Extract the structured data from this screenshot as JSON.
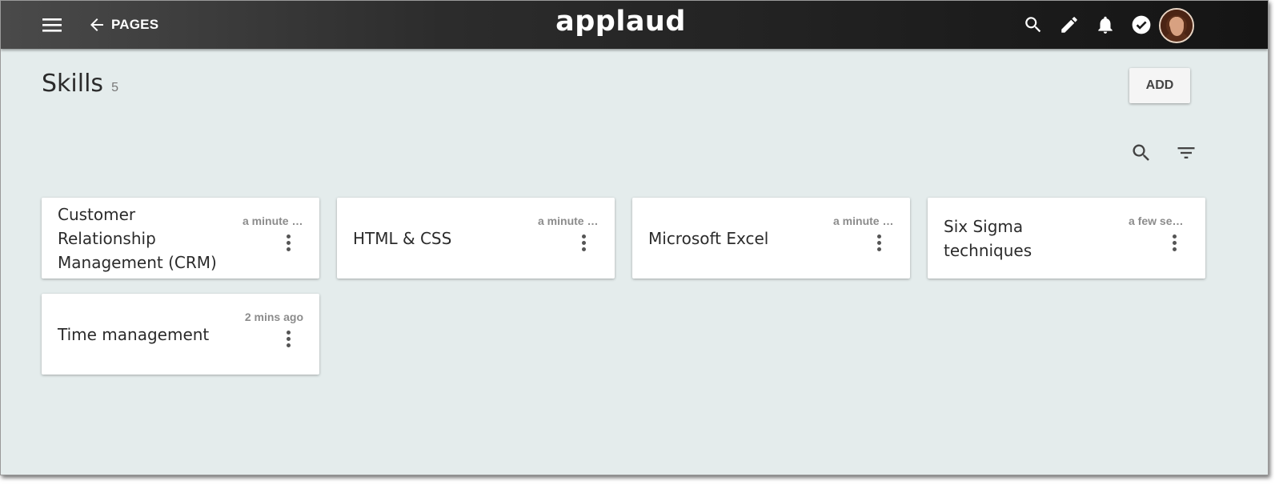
{
  "topbar": {
    "back_label": "PAGES",
    "logo": "applaud",
    "icons": [
      "menu-icon",
      "arrow-back-icon",
      "search-icon",
      "edit-pencil-icon",
      "notifications-bell-icon",
      "check-circle-icon",
      "user-avatar"
    ]
  },
  "page": {
    "title": "Skills",
    "count": "5",
    "add_label": "ADD",
    "tools": [
      "search-icon",
      "filter-icon"
    ]
  },
  "cards": [
    {
      "name": "Customer Relationship Management (CRM)",
      "time": "a minute ago"
    },
    {
      "name": "HTML & CSS",
      "time": "a minute ago"
    },
    {
      "name": "Microsoft Excel",
      "time": "a minute ago"
    },
    {
      "name": "Six Sigma techniques",
      "time": "a few secs ago"
    },
    {
      "name": "Time management",
      "time": "2 mins ago"
    }
  ],
  "colors": {
    "background": "#e4ecec",
    "topbar": "#1e1e1e",
    "card": "#ffffff"
  }
}
